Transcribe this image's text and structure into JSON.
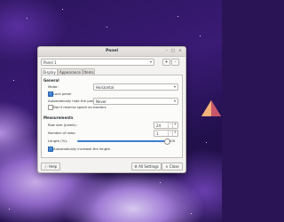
{
  "window": {
    "title": "Panel",
    "minimize_glyph": "–",
    "maximize_glyph": "□",
    "close_glyph": "×"
  },
  "panel_selector": {
    "selected": "Panel 1",
    "add_glyph": "+",
    "remove_glyph": "–"
  },
  "tabs": [
    {
      "label": "Display",
      "active": true
    },
    {
      "label": "Appearance",
      "active": false
    },
    {
      "label": "Items",
      "active": false
    }
  ],
  "general": {
    "header": "General",
    "mode_label": "Mode:",
    "mode_value": "Horizontal",
    "lock_panel_label": "Lock panel",
    "lock_panel_checked": true,
    "autohide_label": "Automatically hide the panel:",
    "autohide_value": "Never",
    "reserve_label": "Don't reserve space on borders",
    "reserve_checked": false
  },
  "measurements": {
    "header": "Measurements",
    "row_size_label": "Row size (pixels):",
    "row_size_value": "24",
    "rows_label": "Number of rows:",
    "rows_value": "1",
    "length_label": "Length (%):",
    "length_value": "100",
    "length_fraction": 1.0,
    "auto_length_label": "Automatically increase the length",
    "auto_length_checked": true
  },
  "footer": {
    "help_label": "Help",
    "all_settings_label": "All Settings",
    "close_label": "Close"
  },
  "colors": {
    "accent": "#3b7fd0"
  }
}
